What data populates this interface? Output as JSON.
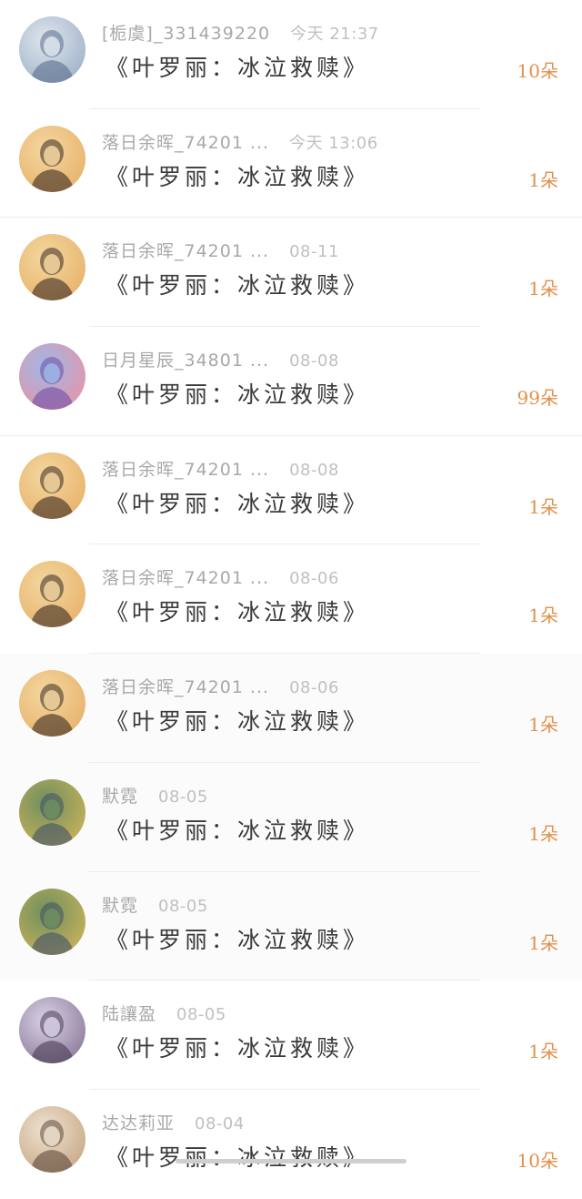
{
  "records": [
    {
      "name": "[栀虞]_331439220",
      "time": "今天 21:37",
      "gift": "《叶罗丽：冰泣救赎》",
      "count": "10朵",
      "avatar": "avatar-anime-white-hair",
      "colors": [
        "#dfe6ee",
        "#9fb2c8",
        "#5a6e8c"
      ]
    },
    {
      "name": "落日余晖_74201 ...",
      "time": "今天 13:06",
      "gift": "《叶罗丽：冰泣救赎》",
      "count": "1朵",
      "avatar": "avatar-sunset-girl",
      "colors": [
        "#f4d7a0",
        "#e7b26a",
        "#3b2a22"
      ]
    },
    {
      "name": "落日余晖_74201 ...",
      "time": "08-11",
      "gift": "《叶罗丽：冰泣救赎》",
      "count": "1朵",
      "avatar": "avatar-sunset-girl",
      "colors": [
        "#f4d7a0",
        "#e7b26a",
        "#3b2a22"
      ]
    },
    {
      "name": "日月星辰_34801 ...",
      "time": "08-08",
      "gift": "《叶罗丽：冰泣救赎》",
      "count": "99朵",
      "avatar": "avatar-anime-pink-hair",
      "colors": [
        "#9fb8e6",
        "#e893a8",
        "#6c4ea8"
      ]
    },
    {
      "name": "落日余晖_74201 ...",
      "time": "08-08",
      "gift": "《叶罗丽：冰泣救赎》",
      "count": "1朵",
      "avatar": "avatar-sunset-girl",
      "colors": [
        "#f4d7a0",
        "#e7b26a",
        "#3b2a22"
      ]
    },
    {
      "name": "落日余晖_74201 ...",
      "time": "08-06",
      "gift": "《叶罗丽：冰泣救赎》",
      "count": "1朵",
      "avatar": "avatar-sunset-girl",
      "colors": [
        "#f4d7a0",
        "#e7b26a",
        "#3b2a22"
      ]
    },
    {
      "name": "落日余晖_74201 ...",
      "time": "08-06",
      "gift": "《叶罗丽：冰泣救赎》",
      "count": "1朵",
      "avatar": "avatar-sunset-girl",
      "colors": [
        "#f4d7a0",
        "#e7b26a",
        "#3b2a22"
      ]
    },
    {
      "name": "默霓",
      "time": "08-05",
      "gift": "《叶罗丽：冰泣救赎》",
      "count": "1朵",
      "avatar": "avatar-armored-figure",
      "colors": [
        "#6f8f5e",
        "#c9b25a",
        "#41506a"
      ]
    },
    {
      "name": "默霓",
      "time": "08-05",
      "gift": "《叶罗丽：冰泣救赎》",
      "count": "1朵",
      "avatar": "avatar-armored-figure",
      "colors": [
        "#6f8f5e",
        "#c9b25a",
        "#41506a"
      ]
    },
    {
      "name": "陆讓盈",
      "time": "08-05",
      "gift": "《叶罗丽：冰泣救赎》",
      "count": "1朵",
      "avatar": "avatar-illustrated-woman",
      "colors": [
        "#d9d2e6",
        "#8c7a9a",
        "#4a3c52"
      ]
    },
    {
      "name": "达达莉亚",
      "time": "08-04",
      "gift": "《叶罗丽：冰泣救赎》",
      "count": "10朵",
      "avatar": "avatar-anime-blonde",
      "colors": [
        "#efe2cf",
        "#c7a887",
        "#5e4a3c"
      ]
    }
  ],
  "accent_color": "#e2904a"
}
